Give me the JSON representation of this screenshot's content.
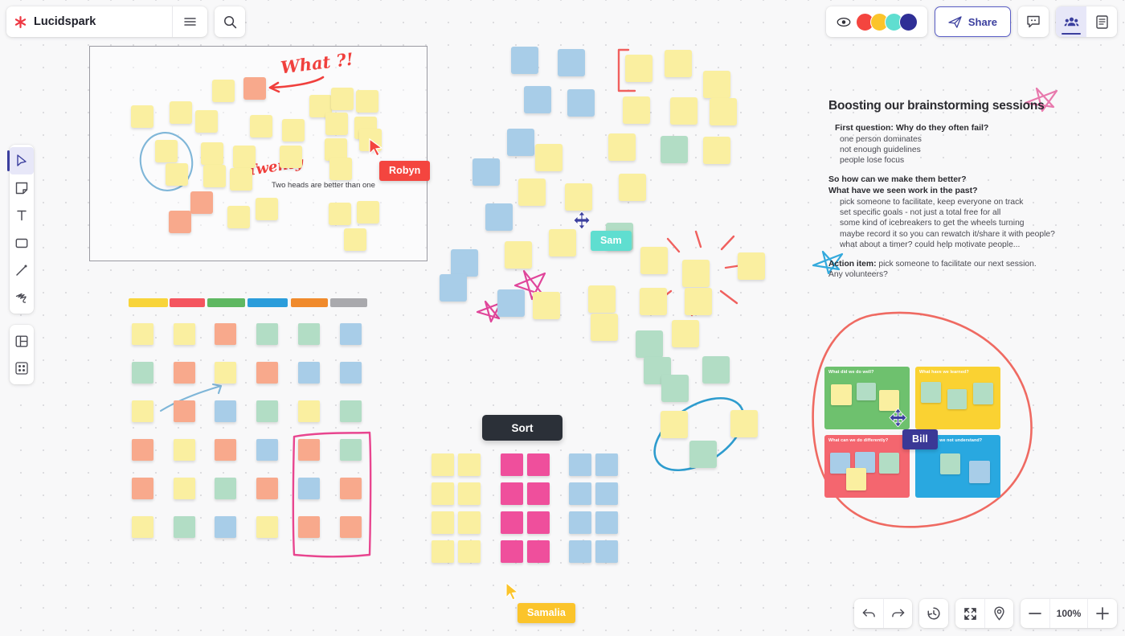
{
  "app": {
    "title": "Lucidspark",
    "logo_icon": "lucid-asterisk-icon",
    "menu_icon": "hamburger-menu-icon",
    "search_icon": "search-icon"
  },
  "topbar": {
    "follow_icon": "eye-follow-icon",
    "avatars": [
      {
        "name": "Robyn",
        "color": "#f4453f"
      },
      {
        "name": "Samalia",
        "color": "#fbc42b"
      },
      {
        "name": "Sam",
        "color": "#5fded0"
      },
      {
        "name": "Bill",
        "color": "#2f2f96"
      }
    ],
    "share_label": "Share",
    "share_icon": "paper-plane-icon",
    "comment_icon": "comment-icon",
    "collaborators_icon": "people-group-icon",
    "notes_panel_icon": "document-panel-icon"
  },
  "left_toolbar": {
    "tools": [
      {
        "name": "select-tool",
        "icon": "cursor-arrow-icon",
        "active": true
      },
      {
        "name": "sticky-note-tool",
        "icon": "sticky-note-icon",
        "active": false
      },
      {
        "name": "text-tool",
        "icon": "text-t-icon",
        "active": false
      },
      {
        "name": "shape-tool",
        "icon": "rectangle-icon",
        "active": false
      },
      {
        "name": "line-tool",
        "icon": "pen-line-icon",
        "active": false
      },
      {
        "name": "freehand-tool",
        "icon": "scribble-icon",
        "active": false
      }
    ],
    "tools_secondary": [
      {
        "name": "templates-tool",
        "icon": "template-layout-icon"
      },
      {
        "name": "integrations-tool",
        "icon": "grid-apps-icon"
      }
    ]
  },
  "bottom_bar": {
    "undo_icon": "undo-arrow-icon",
    "redo_icon": "redo-arrow-icon",
    "history_icon": "history-clock-icon",
    "fit_icon": "fit-to-screen-icon",
    "minimap_icon": "map-pin-icon",
    "zoom_out_label": "−",
    "zoom_level": "100%",
    "zoom_in_label": "+"
  },
  "canvas": {
    "background": "#f8f8f9",
    "sort_tooltip": "Sort",
    "annotations": {
      "what_text": "What ?!",
      "twenty_text": "Twenty",
      "quote_text": "Two heads are better than one"
    },
    "cursors": [
      {
        "label": "Robyn",
        "color": "#f4453f"
      },
      {
        "label": "Sam",
        "color": "#5fded0"
      },
      {
        "label": "Samalia",
        "color": "#fbc42b"
      },
      {
        "label": "Bill",
        "color": "#3a3896"
      }
    ],
    "swatch_bars": [
      "#f8d43a",
      "#f4555f",
      "#5fb862",
      "#2b9ddb",
      "#f08a2c",
      "#a9a9ad"
    ],
    "note_colors": {
      "yellow": "#faefa0",
      "salmon": "#f8a98c",
      "green": "#b2ddc5",
      "blue": "#a8cde8",
      "magenta": "#ef4f9c"
    }
  },
  "notes_panel": {
    "heading": "Boosting our brainstorming sessions",
    "q1": "First question: Why do they often fail?",
    "q1_items": [
      "one person dominates",
      "not enough guidelines",
      "people lose focus"
    ],
    "q2a": "So how can we make them better?",
    "q2b": "What have we seen work in the past?",
    "q2_items": [
      "pick someone to facilitate, keep everyone on track",
      "set specific goals - not just a total free for all",
      "some kind of icebreakers to get the wheels turning",
      "maybe record it so you can rewatch it/share it with people?",
      "what about a timer? could help motivate people..."
    ],
    "action_label": "Action item:",
    "action_text": " pick someone to facilitate our next session.",
    "action_text2": "Any volunteers?"
  },
  "retro_board": {
    "quadrants": [
      {
        "title": "What did we do well?",
        "color": "#6ec16e"
      },
      {
        "title": "What have we learned?",
        "color": "#fad232"
      },
      {
        "title": "What can we do differently?",
        "color": "#f4666f"
      },
      {
        "title": "What did we not understand?",
        "color": "#29a8e0"
      }
    ]
  }
}
